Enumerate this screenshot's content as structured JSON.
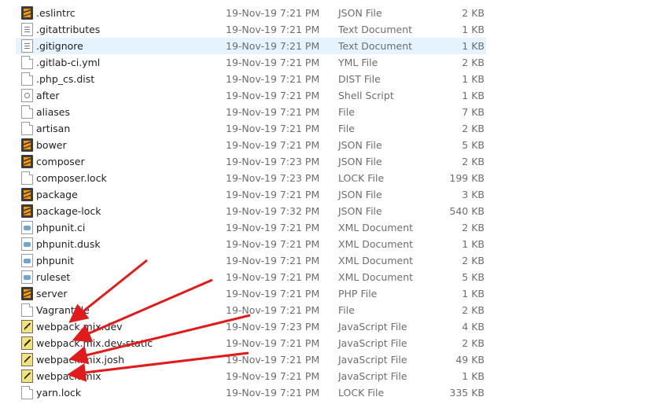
{
  "files": [
    {
      "name": ".eslintrc",
      "date": "19-Nov-19 7:21 PM",
      "type": "JSON File",
      "size": "2 KB",
      "icon": "sublime-file-icon"
    },
    {
      "name": ".gitattributes",
      "date": "19-Nov-19 7:21 PM",
      "type": "Text Document",
      "size": "1 KB",
      "icon": "text-document-icon"
    },
    {
      "name": ".gitignore",
      "date": "19-Nov-19 7:21 PM",
      "type": "Text Document",
      "size": "1 KB",
      "icon": "text-document-icon",
      "selected": true
    },
    {
      "name": ".gitlab-ci.yml",
      "date": "19-Nov-19 7:21 PM",
      "type": "YML File",
      "size": "2 KB",
      "icon": "generic-file-icon"
    },
    {
      "name": ".php_cs.dist",
      "date": "19-Nov-19 7:21 PM",
      "type": "DIST File",
      "size": "1 KB",
      "icon": "generic-file-icon"
    },
    {
      "name": "after",
      "date": "19-Nov-19 7:21 PM",
      "type": "Shell Script",
      "size": "1 KB",
      "icon": "shell-script-icon"
    },
    {
      "name": "aliases",
      "date": "19-Nov-19 7:21 PM",
      "type": "File",
      "size": "7 KB",
      "icon": "generic-file-icon"
    },
    {
      "name": "artisan",
      "date": "19-Nov-19 7:21 PM",
      "type": "File",
      "size": "2 KB",
      "icon": "generic-file-icon"
    },
    {
      "name": "bower",
      "date": "19-Nov-19 7:21 PM",
      "type": "JSON File",
      "size": "5 KB",
      "icon": "sublime-file-icon"
    },
    {
      "name": "composer",
      "date": "19-Nov-19 7:23 PM",
      "type": "JSON File",
      "size": "2 KB",
      "icon": "sublime-file-icon"
    },
    {
      "name": "composer.lock",
      "date": "19-Nov-19 7:23 PM",
      "type": "LOCK File",
      "size": "199 KB",
      "icon": "generic-file-icon"
    },
    {
      "name": "package",
      "date": "19-Nov-19 7:21 PM",
      "type": "JSON File",
      "size": "3 KB",
      "icon": "sublime-file-icon"
    },
    {
      "name": "package-lock",
      "date": "19-Nov-19 7:32 PM",
      "type": "JSON File",
      "size": "540 KB",
      "icon": "sublime-file-icon"
    },
    {
      "name": "phpunit.ci",
      "date": "19-Nov-19 7:21 PM",
      "type": "XML Document",
      "size": "2 KB",
      "icon": "xml-document-icon"
    },
    {
      "name": "phpunit.dusk",
      "date": "19-Nov-19 7:21 PM",
      "type": "XML Document",
      "size": "1 KB",
      "icon": "xml-document-icon"
    },
    {
      "name": "phpunit",
      "date": "19-Nov-19 7:21 PM",
      "type": "XML Document",
      "size": "2 KB",
      "icon": "xml-document-icon"
    },
    {
      "name": "ruleset",
      "date": "19-Nov-19 7:21 PM",
      "type": "XML Document",
      "size": "5 KB",
      "icon": "xml-document-icon"
    },
    {
      "name": "server",
      "date": "19-Nov-19 7:21 PM",
      "type": "PHP File",
      "size": "1 KB",
      "icon": "sublime-file-icon"
    },
    {
      "name": "Vagrantfile",
      "date": "19-Nov-19 7:21 PM",
      "type": "File",
      "size": "2 KB",
      "icon": "generic-file-icon"
    },
    {
      "name": "webpack.mix.dev",
      "date": "19-Nov-19 7:23 PM",
      "type": "JavaScript File",
      "size": "4 KB",
      "icon": "javascript-file-icon"
    },
    {
      "name": "webpack.mix.dev-static",
      "date": "19-Nov-19 7:21 PM",
      "type": "JavaScript File",
      "size": "2 KB",
      "icon": "javascript-file-icon"
    },
    {
      "name": "webpack.mix.josh",
      "date": "19-Nov-19 7:21 PM",
      "type": "JavaScript File",
      "size": "49 KB",
      "icon": "javascript-file-icon"
    },
    {
      "name": "webpack.mix",
      "date": "19-Nov-19 7:21 PM",
      "type": "JavaScript File",
      "size": "1 KB",
      "icon": "javascript-file-icon"
    },
    {
      "name": "yarn.lock",
      "date": "19-Nov-19 7:21 PM",
      "type": "LOCK File",
      "size": "335 KB",
      "icon": "generic-file-icon"
    }
  ],
  "colors": {
    "selection": "#e5f3ff",
    "annotation_arrow": "#e01b1b",
    "secondary_text": "#6d6d6d"
  }
}
